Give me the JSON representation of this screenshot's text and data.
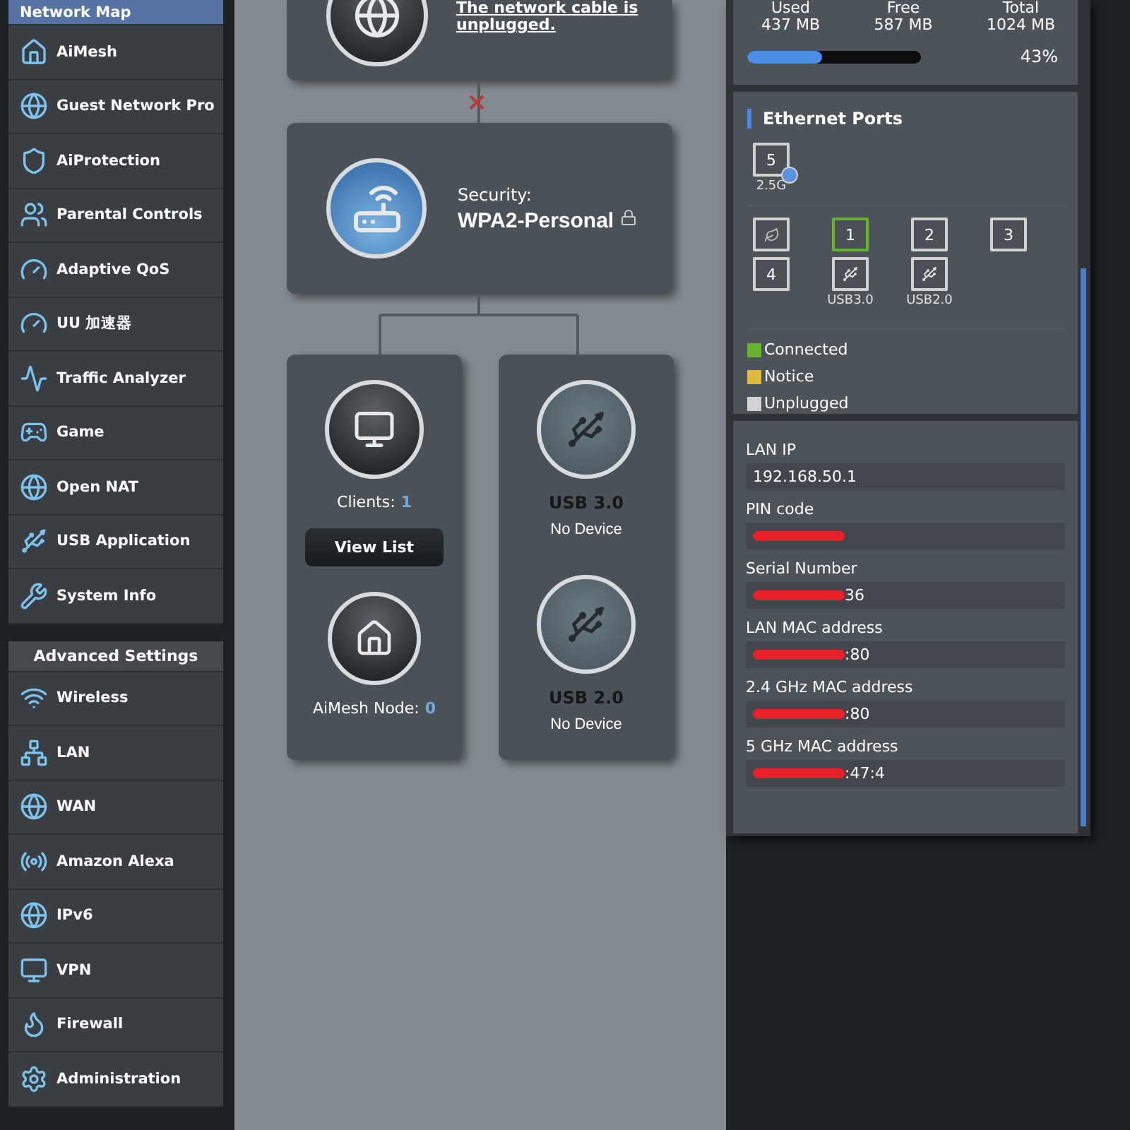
{
  "sidebar": {
    "general_items": [
      {
        "label": "Network Map",
        "selected": true
      },
      {
        "label": "AiMesh",
        "selected": false
      },
      {
        "label": "Guest Network Pro",
        "selected": false
      },
      {
        "label": "AiProtection",
        "selected": false
      },
      {
        "label": "Parental Controls",
        "selected": false
      },
      {
        "label": "Adaptive QoS",
        "selected": false
      },
      {
        "label": "UU 加速器",
        "selected": false
      },
      {
        "label": "Traffic Analyzer",
        "selected": false
      },
      {
        "label": "Game",
        "selected": false
      },
      {
        "label": "Open NAT",
        "selected": false
      },
      {
        "label": "USB Application",
        "selected": false
      },
      {
        "label": "System Info",
        "selected": false
      }
    ],
    "advanced_title": "Advanced Settings",
    "advanced_items": [
      {
        "label": "Wireless",
        "selected": false
      },
      {
        "label": "LAN",
        "selected": false
      },
      {
        "label": "WAN",
        "selected": false
      },
      {
        "label": "Amazon Alexa",
        "selected": false
      },
      {
        "label": "IPv6",
        "selected": false
      },
      {
        "label": "VPN",
        "selected": false
      },
      {
        "label": "Firewall",
        "selected": false
      },
      {
        "label": "Administration",
        "selected": false
      }
    ]
  },
  "internet": {
    "status_lines": [
      "The network cable is",
      "unplugged."
    ]
  },
  "router": {
    "security_label": "Security:",
    "security_value": "WPA2-Personal"
  },
  "clients": {
    "label": "Clients:",
    "count": "1",
    "button": "View List",
    "aimesh_label": "AiMesh Node:",
    "aimesh_count": "0"
  },
  "usb": [
    {
      "title": "USB 3.0",
      "status": "No Device"
    },
    {
      "title": "USB 2.0",
      "status": "No Device"
    }
  ],
  "memory": {
    "columns": [
      {
        "label": "Used",
        "value": "437 MB"
      },
      {
        "label": "Free",
        "value": "587 MB"
      },
      {
        "label": "Total",
        "value": "1024 MB"
      }
    ],
    "level": 0.43,
    "percent": "43%"
  },
  "ethernet": {
    "title": "Ethernet Ports",
    "top_ports": [
      {
        "kind": "lan",
        "number": "5",
        "caption": "2.5G",
        "connected": false,
        "badge": true
      }
    ],
    "ports": [
      {
        "kind": "wan",
        "connected": false
      },
      {
        "kind": "lan",
        "number": "1",
        "connected": true
      },
      {
        "kind": "lan",
        "number": "2",
        "connected": false
      },
      {
        "kind": "lan",
        "number": "3",
        "connected": false
      },
      {
        "kind": "lan",
        "number": "4",
        "connected": false
      },
      {
        "kind": "usb",
        "caption": "USB3.0",
        "connected": false
      },
      {
        "kind": "usb",
        "caption": "USB2.0",
        "connected": false
      }
    ],
    "legend": [
      {
        "label": "Connected",
        "color": "#66b32e"
      },
      {
        "label": "Notice",
        "color": "#dfb83c"
      },
      {
        "label": "Unplugged",
        "color": "#d2d2d2"
      }
    ]
  },
  "info": [
    {
      "label": "LAN IP",
      "value": "192.168.50.1",
      "redacted": false
    },
    {
      "label": "PIN code",
      "redacted": true
    },
    {
      "label": "Serial Number",
      "value": "36",
      "redacted": true
    },
    {
      "label": "LAN MAC address",
      "value": ":80",
      "redacted": true
    },
    {
      "label": "2.4 GHz MAC address",
      "value": ":80",
      "redacted": true
    },
    {
      "label": "5 GHz MAC address",
      "value": ":47:4",
      "redacted": true
    }
  ]
}
